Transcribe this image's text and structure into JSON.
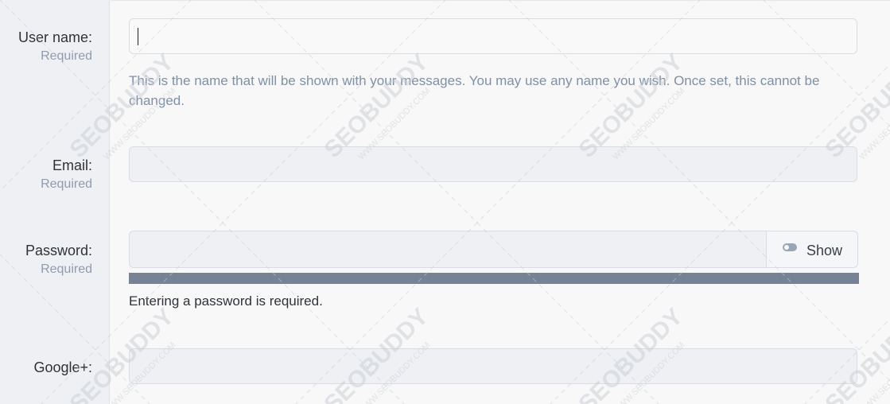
{
  "form": {
    "username": {
      "label": "User name:",
      "hint": "Required",
      "value": "",
      "help": "This is the name that will be shown with your messages. You may use any name you wish. Once set, this cannot be changed."
    },
    "email": {
      "label": "Email:",
      "hint": "Required",
      "value": ""
    },
    "password": {
      "label": "Password:",
      "hint": "Required",
      "value": "",
      "show_label": "Show",
      "strength_message": "Entering a password is required."
    },
    "google_plus": {
      "label": "Google+:",
      "value": ""
    }
  },
  "watermark": {
    "brand": "SEOBUDDY",
    "site": "WWW.SEOBUDDY.COM"
  },
  "colors": {
    "label_column": "#eef0f3",
    "hint_text": "#8f9cb0",
    "strength_bar": "#778395"
  },
  "icons": {
    "show_toggle": "toggle-icon"
  }
}
